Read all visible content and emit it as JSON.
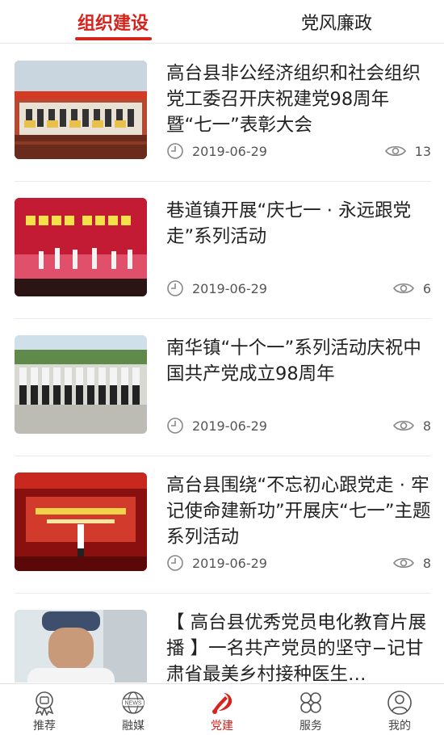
{
  "colors": {
    "accent": "#d8231c"
  },
  "top_tabs": [
    {
      "label": "组织建设",
      "active": true
    },
    {
      "label": "党风廉政",
      "active": false
    }
  ],
  "articles": [
    {
      "title": "高台县非公经济组织和社会组织党工委召开庆祝建党98周年暨“七一”表彰大会",
      "date": "2019-06-29",
      "views": "13",
      "image": "meeting-stage-photo"
    },
    {
      "title": "巷道镇开展“庆七一 · 永远跟党走”系列活动",
      "date": "2019-06-29",
      "views": "6",
      "image": "stage-dance-photo"
    },
    {
      "title": "南华镇“十个一”系列活动庆祝中国共产党成立98周年",
      "date": "2019-06-29",
      "views": "8",
      "image": "group-oath-photo"
    },
    {
      "title": "高台县围绕“不忘初心跟党走 · 牢记使命建新功”开展庆“七一”主题系列活动",
      "date": "2019-06-29",
      "views": "8",
      "image": "speech-stage-photo"
    },
    {
      "title": "【 高台县优秀党员电化教育片展播 】一名共产党员的坚守−记甘肃省最美乡村接种医生…",
      "image": "doctor-portrait-photo"
    }
  ],
  "bottom_nav": [
    {
      "label": "推荐",
      "icon": "recommend-icon",
      "active": false
    },
    {
      "label": "融媒",
      "icon": "news-globe-icon",
      "icon_text": "NEWS",
      "active": false
    },
    {
      "label": "党建",
      "icon": "party-emblem-icon",
      "active": true
    },
    {
      "label": "服务",
      "icon": "services-grid-icon",
      "active": false
    },
    {
      "label": "我的",
      "icon": "user-profile-icon",
      "active": false
    }
  ]
}
